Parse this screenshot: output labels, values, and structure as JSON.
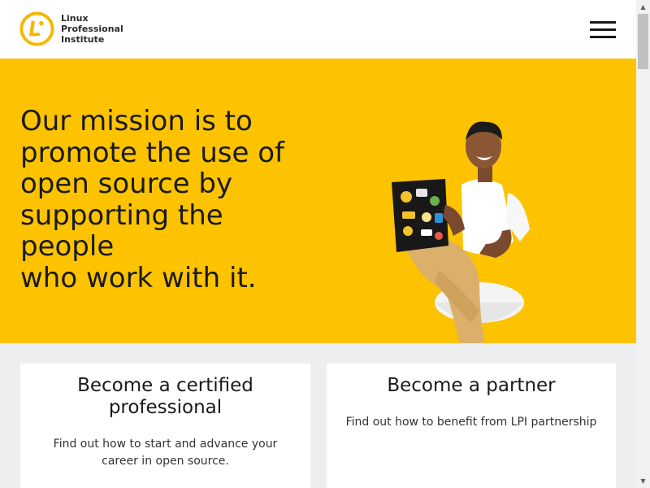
{
  "header": {
    "logo_lines": [
      "Linux",
      "Professional",
      "Institute"
    ],
    "logo_icon": "lpi-logo-icon",
    "menu_icon": "hamburger-menu-icon"
  },
  "hero": {
    "heading_lines": [
      "Our mission is to",
      "promote the use of",
      "open source by",
      "supporting the",
      "people",
      "who work with it."
    ],
    "image": "person-with-laptop-photo",
    "background_color": "#fdc300"
  },
  "cards": [
    {
      "title": "Become a certified professional",
      "text": "Find out how to start and advance your career in open source."
    },
    {
      "title": "Become a partner",
      "text": "Find out how to benefit from LPI partnership"
    }
  ],
  "colors": {
    "brand_yellow": "#fdc300",
    "page_background": "#edeef0"
  }
}
